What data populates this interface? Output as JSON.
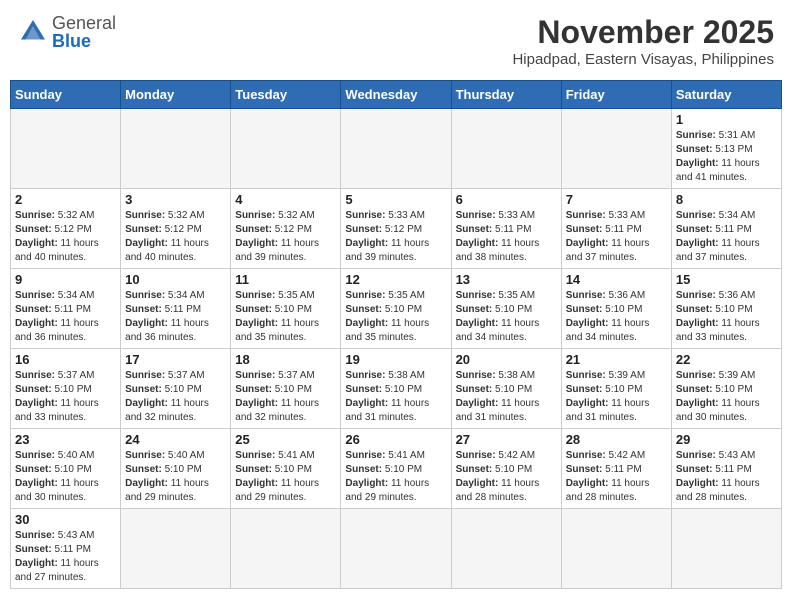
{
  "header": {
    "logo_general": "General",
    "logo_blue": "Blue",
    "main_title": "November 2025",
    "subtitle": "Hipadpad, Eastern Visayas, Philippines"
  },
  "days_of_week": [
    "Sunday",
    "Monday",
    "Tuesday",
    "Wednesday",
    "Thursday",
    "Friday",
    "Saturday"
  ],
  "weeks": [
    [
      {
        "day": "",
        "empty": true
      },
      {
        "day": "",
        "empty": true
      },
      {
        "day": "",
        "empty": true
      },
      {
        "day": "",
        "empty": true
      },
      {
        "day": "",
        "empty": true
      },
      {
        "day": "",
        "empty": true
      },
      {
        "day": "1",
        "sunrise": "5:31 AM",
        "sunset": "5:13 PM",
        "daylight": "11 hours and 41 minutes."
      }
    ],
    [
      {
        "day": "2",
        "sunrise": "5:32 AM",
        "sunset": "5:12 PM",
        "daylight": "11 hours and 40 minutes."
      },
      {
        "day": "3",
        "sunrise": "5:32 AM",
        "sunset": "5:12 PM",
        "daylight": "11 hours and 40 minutes."
      },
      {
        "day": "4",
        "sunrise": "5:32 AM",
        "sunset": "5:12 PM",
        "daylight": "11 hours and 39 minutes."
      },
      {
        "day": "5",
        "sunrise": "5:33 AM",
        "sunset": "5:12 PM",
        "daylight": "11 hours and 39 minutes."
      },
      {
        "day": "6",
        "sunrise": "5:33 AM",
        "sunset": "5:11 PM",
        "daylight": "11 hours and 38 minutes."
      },
      {
        "day": "7",
        "sunrise": "5:33 AM",
        "sunset": "5:11 PM",
        "daylight": "11 hours and 37 minutes."
      },
      {
        "day": "8",
        "sunrise": "5:34 AM",
        "sunset": "5:11 PM",
        "daylight": "11 hours and 37 minutes."
      }
    ],
    [
      {
        "day": "9",
        "sunrise": "5:34 AM",
        "sunset": "5:11 PM",
        "daylight": "11 hours and 36 minutes."
      },
      {
        "day": "10",
        "sunrise": "5:34 AM",
        "sunset": "5:11 PM",
        "daylight": "11 hours and 36 minutes."
      },
      {
        "day": "11",
        "sunrise": "5:35 AM",
        "sunset": "5:10 PM",
        "daylight": "11 hours and 35 minutes."
      },
      {
        "day": "12",
        "sunrise": "5:35 AM",
        "sunset": "5:10 PM",
        "daylight": "11 hours and 35 minutes."
      },
      {
        "day": "13",
        "sunrise": "5:35 AM",
        "sunset": "5:10 PM",
        "daylight": "11 hours and 34 minutes."
      },
      {
        "day": "14",
        "sunrise": "5:36 AM",
        "sunset": "5:10 PM",
        "daylight": "11 hours and 34 minutes."
      },
      {
        "day": "15",
        "sunrise": "5:36 AM",
        "sunset": "5:10 PM",
        "daylight": "11 hours and 33 minutes."
      }
    ],
    [
      {
        "day": "16",
        "sunrise": "5:37 AM",
        "sunset": "5:10 PM",
        "daylight": "11 hours and 33 minutes."
      },
      {
        "day": "17",
        "sunrise": "5:37 AM",
        "sunset": "5:10 PM",
        "daylight": "11 hours and 32 minutes."
      },
      {
        "day": "18",
        "sunrise": "5:37 AM",
        "sunset": "5:10 PM",
        "daylight": "11 hours and 32 minutes."
      },
      {
        "day": "19",
        "sunrise": "5:38 AM",
        "sunset": "5:10 PM",
        "daylight": "11 hours and 31 minutes."
      },
      {
        "day": "20",
        "sunrise": "5:38 AM",
        "sunset": "5:10 PM",
        "daylight": "11 hours and 31 minutes."
      },
      {
        "day": "21",
        "sunrise": "5:39 AM",
        "sunset": "5:10 PM",
        "daylight": "11 hours and 31 minutes."
      },
      {
        "day": "22",
        "sunrise": "5:39 AM",
        "sunset": "5:10 PM",
        "daylight": "11 hours and 30 minutes."
      }
    ],
    [
      {
        "day": "23",
        "sunrise": "5:40 AM",
        "sunset": "5:10 PM",
        "daylight": "11 hours and 30 minutes."
      },
      {
        "day": "24",
        "sunrise": "5:40 AM",
        "sunset": "5:10 PM",
        "daylight": "11 hours and 29 minutes."
      },
      {
        "day": "25",
        "sunrise": "5:41 AM",
        "sunset": "5:10 PM",
        "daylight": "11 hours and 29 minutes."
      },
      {
        "day": "26",
        "sunrise": "5:41 AM",
        "sunset": "5:10 PM",
        "daylight": "11 hours and 29 minutes."
      },
      {
        "day": "27",
        "sunrise": "5:42 AM",
        "sunset": "5:10 PM",
        "daylight": "11 hours and 28 minutes."
      },
      {
        "day": "28",
        "sunrise": "5:42 AM",
        "sunset": "5:11 PM",
        "daylight": "11 hours and 28 minutes."
      },
      {
        "day": "29",
        "sunrise": "5:43 AM",
        "sunset": "5:11 PM",
        "daylight": "11 hours and 28 minutes."
      }
    ],
    [
      {
        "day": "30",
        "sunrise": "5:43 AM",
        "sunset": "5:11 PM",
        "daylight": "11 hours and 27 minutes."
      },
      {
        "day": "",
        "empty": true
      },
      {
        "day": "",
        "empty": true
      },
      {
        "day": "",
        "empty": true
      },
      {
        "day": "",
        "empty": true
      },
      {
        "day": "",
        "empty": true
      },
      {
        "day": "",
        "empty": true
      }
    ]
  ],
  "labels": {
    "sunrise": "Sunrise:",
    "sunset": "Sunset:",
    "daylight": "Daylight:"
  },
  "accent_color": "#2e6db4"
}
